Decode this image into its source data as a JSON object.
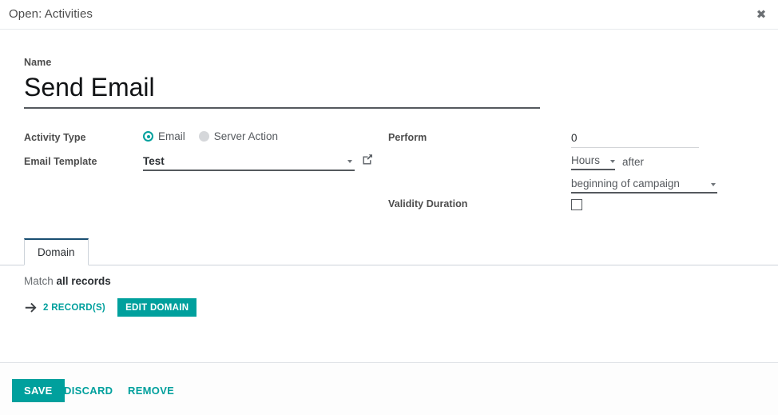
{
  "dialog": {
    "title": "Open: Activities",
    "close_icon": "close-icon"
  },
  "form": {
    "name": {
      "label": "Name",
      "value": "Send Email"
    },
    "activity_type": {
      "label": "Activity Type",
      "options": [
        {
          "label": "Email",
          "selected": true
        },
        {
          "label": "Server Action",
          "selected": false
        }
      ]
    },
    "email_template": {
      "label": "Email Template",
      "value": "Test",
      "caret_icon": "chevron-down-icon",
      "external_icon": "external-link-icon"
    },
    "perform": {
      "label": "Perform",
      "interval_value": "0",
      "unit": "Hours",
      "unit_caret_icon": "chevron-down-icon",
      "after_text": "after",
      "trigger": "beginning of campaign",
      "trigger_caret_icon": "chevron-down-icon"
    },
    "validity_duration": {
      "label": "Validity Duration",
      "checked": false
    }
  },
  "notebook": {
    "tabs": [
      {
        "label": "Domain",
        "active": true
      }
    ],
    "domain_page": {
      "match_prefix": "Match",
      "match_value": "all records",
      "arrow_icon": "arrow-right-icon",
      "record_count_label": "2 RECORD(S)",
      "edit_domain_label": "EDIT DOMAIN"
    }
  },
  "footer": {
    "save_label": "SAVE",
    "discard_label": "DISCARD",
    "remove_label": "REMOVE"
  },
  "colors": {
    "accent": "#00A09D",
    "tab_active_border": "#1a4f72",
    "text_dark": "#2b2f33",
    "text_muted": "#6b6f73"
  }
}
